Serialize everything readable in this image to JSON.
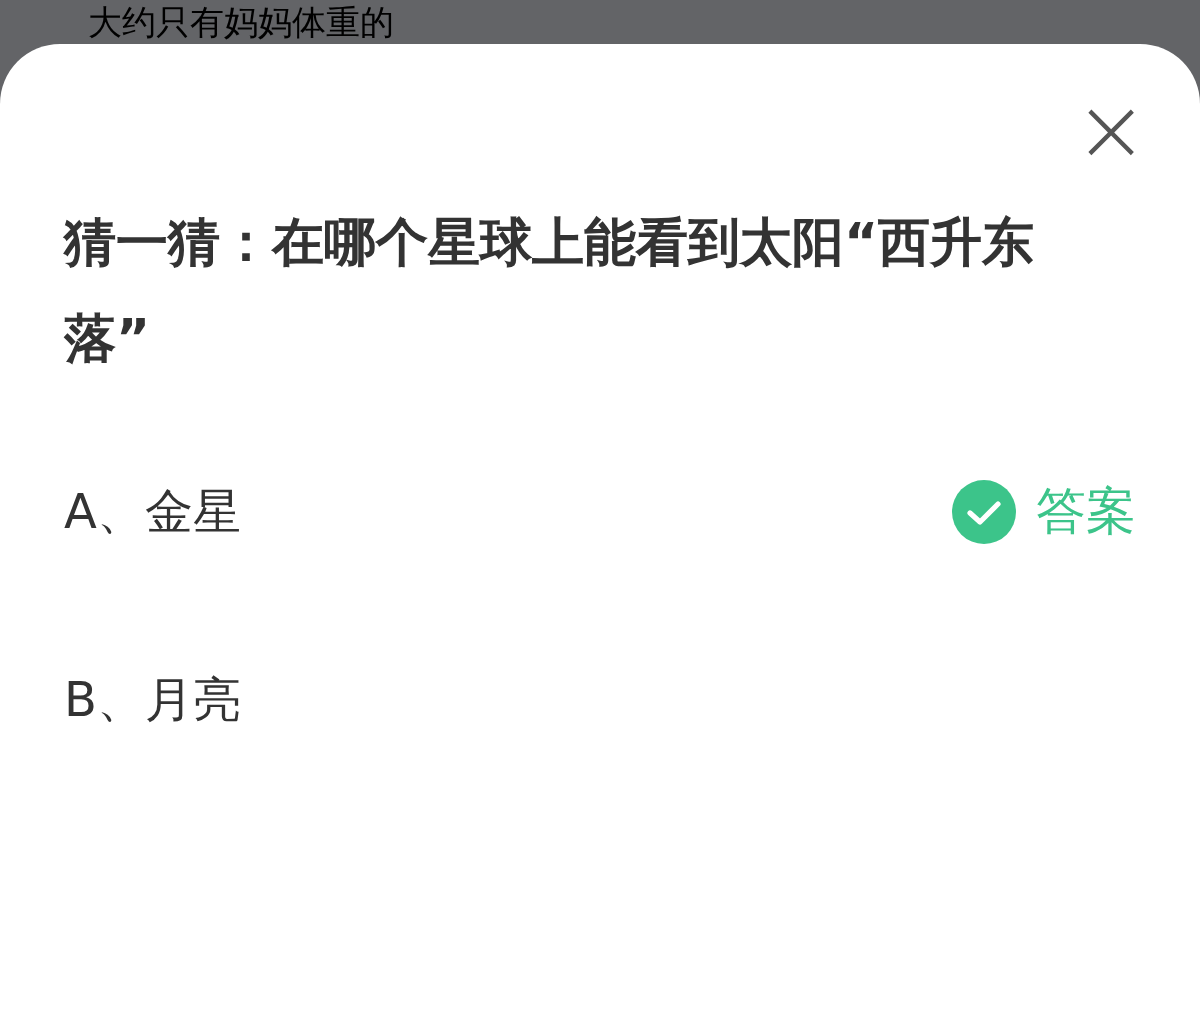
{
  "background_text": "大约只有妈妈体重的",
  "sheet": {
    "close": "×",
    "question": "猜一猜：在哪个星球上能看到太阳“西升东落”",
    "answer_label": "答案",
    "options": [
      {
        "label": "A、金星",
        "correct": true
      },
      {
        "label": "B、月亮",
        "correct": false
      }
    ]
  }
}
